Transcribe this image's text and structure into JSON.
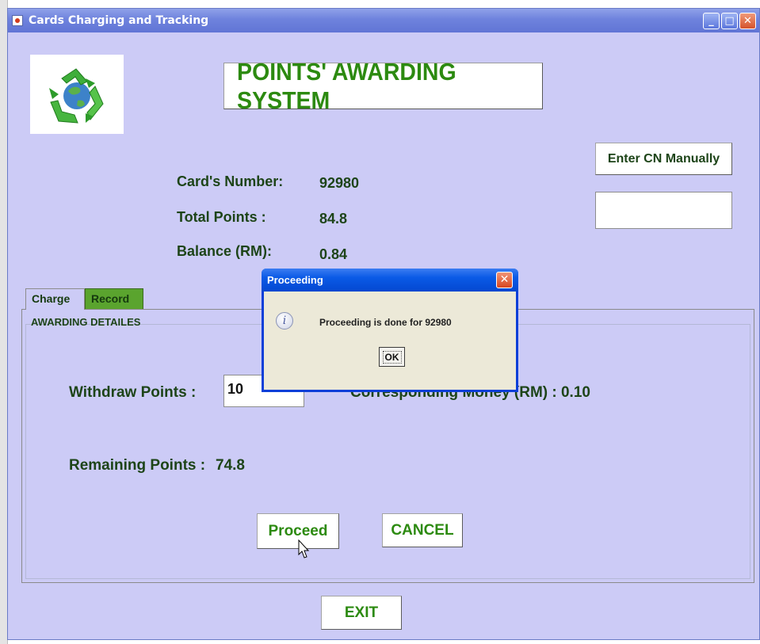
{
  "window": {
    "title": "Cards Charging and Tracking",
    "min_glyph": "_",
    "max_glyph": "□",
    "close_glyph": "✕"
  },
  "header": {
    "title": "POINTS' AWARDING SYSTEM",
    "logo_icon": "recycle-globe-logo"
  },
  "manual": {
    "button_label": "Enter CN Manually",
    "input_value": ""
  },
  "card": {
    "number_label": "Card's Number:",
    "number_value": "92980",
    "points_label": "Total Points :",
    "points_value": "84.8",
    "balance_label": "Balance (RM):",
    "balance_value": "0.84"
  },
  "tabs": [
    {
      "label": "Charge",
      "active": true
    },
    {
      "label": "Record",
      "active": false
    }
  ],
  "panel": {
    "title": "AWARDING DETAILES",
    "withdraw_label": "Withdraw Points :",
    "withdraw_value": "10",
    "money_label": "Corresponding Money (RM) : 0.10",
    "remaining_label": "Remaining Points :",
    "remaining_value": "74.8",
    "proceed_label": "Proceed",
    "cancel_label": "CANCEL"
  },
  "exit_label": "EXIT",
  "dialog": {
    "title": "Proceeding",
    "close_glyph": "✕",
    "icon": "info-icon",
    "icon_glyph": "i",
    "message": "Proceeding is done for 92980",
    "ok_label": "OK"
  },
  "colors": {
    "background": "#cccbf6",
    "accent_green": "#2c8a10",
    "text_dark_green": "#1d4418",
    "titlebar_blue": "#0a5ae6"
  }
}
